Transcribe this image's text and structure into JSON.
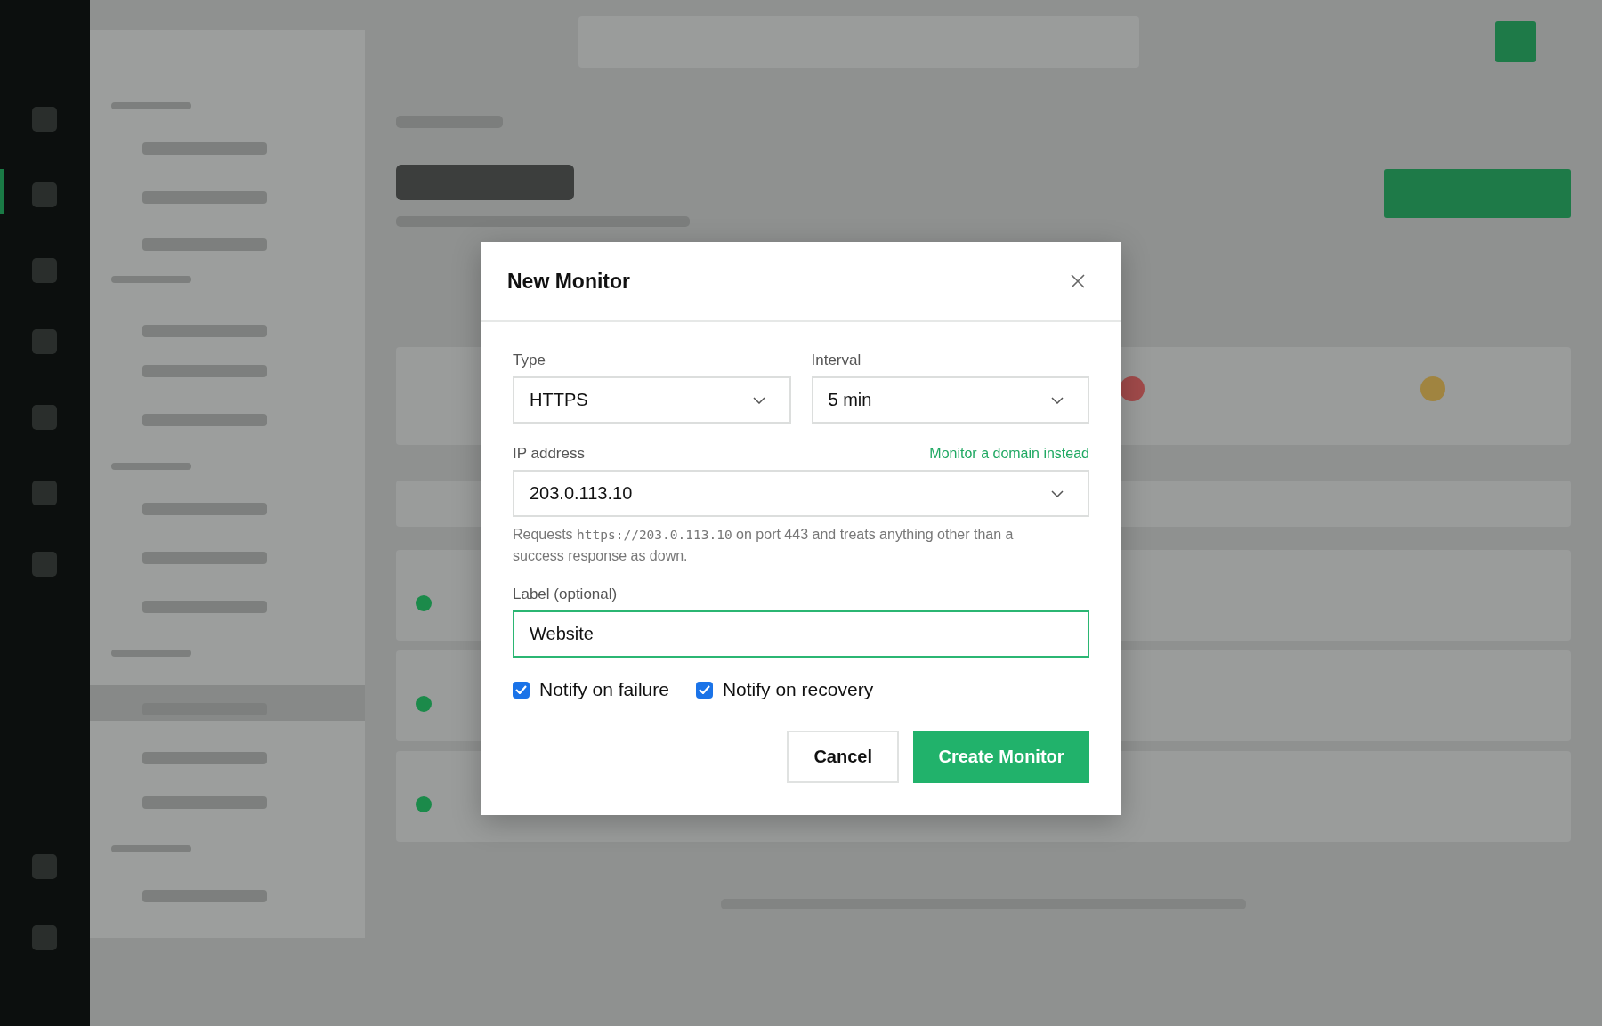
{
  "dialog": {
    "title": "New Monitor",
    "type": {
      "label": "Type",
      "value": "HTTPS"
    },
    "interval": {
      "label": "Interval",
      "value": "5 min"
    },
    "ip_address": {
      "label": "IP address",
      "value": "203.0.113.10",
      "link": "Monitor a domain instead"
    },
    "helper": [
      {
        "kind": "text",
        "text": "Requests "
      },
      {
        "kind": "code",
        "text": "https://203.0.113.10"
      },
      {
        "kind": "text",
        "text": " on port 443 and treats anything other than a success response as down."
      }
    ],
    "label_field": {
      "label": "Label (optional)",
      "value": "Website",
      "focused": true
    },
    "checkboxes": [
      {
        "label": "Notify on failure",
        "checked": true
      },
      {
        "label": "Notify on recovery",
        "checked": true
      }
    ],
    "buttons": [
      {
        "label": "Cancel",
        "kind": "secondary"
      },
      {
        "label": "Create Monitor",
        "kind": "primary"
      }
    ]
  }
}
